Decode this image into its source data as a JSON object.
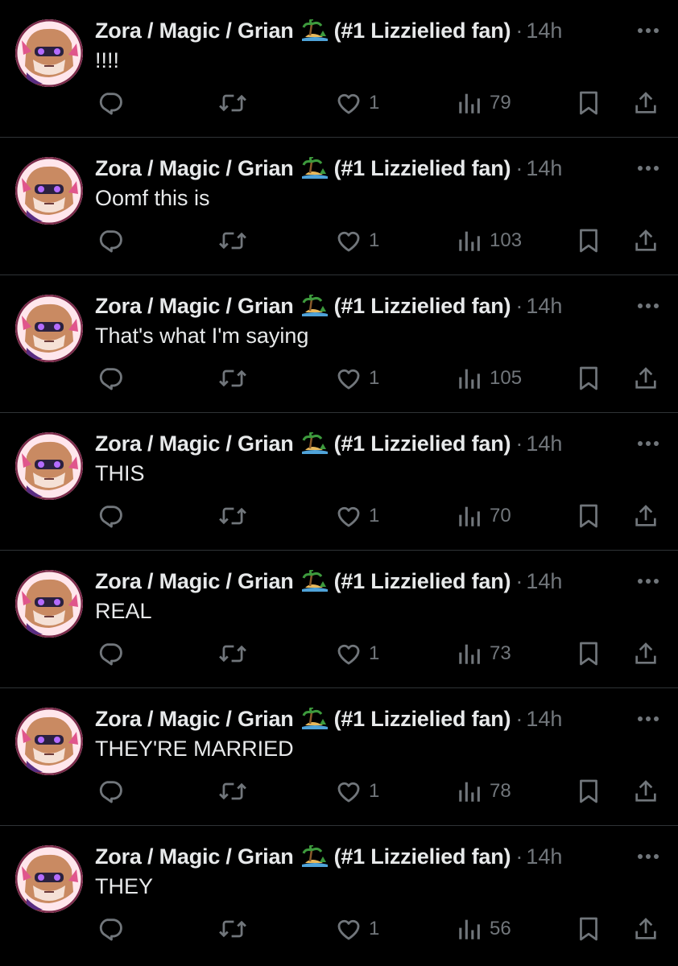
{
  "colors": {
    "background": "#000000",
    "text_primary": "#e7e9ea",
    "text_secondary": "#71767b",
    "divider": "#2f3336"
  },
  "icons": {
    "reply": "reply-icon",
    "retweet": "retweet-icon",
    "like": "heart-icon",
    "views": "views-icon",
    "bookmark": "bookmark-icon",
    "share": "share-icon",
    "more": "more-icon",
    "name_badge": "island-emoji"
  },
  "tweets": [
    {
      "name": "Zora / Magic / Grian",
      "name_suffix": "(#1 Lizzielied fan)",
      "separator": "·",
      "time": "14h",
      "text": "!!!!",
      "likes": "1",
      "views": "79"
    },
    {
      "name": "Zora / Magic / Grian",
      "name_suffix": "(#1 Lizzielied fan)",
      "separator": "·",
      "time": "14h",
      "text": "Oomf this is",
      "likes": "1",
      "views": "103"
    },
    {
      "name": "Zora / Magic / Grian",
      "name_suffix": "(#1 Lizzielied fan)",
      "separator": "·",
      "time": "14h",
      "text": "That's what I'm saying",
      "likes": "1",
      "views": "105"
    },
    {
      "name": "Zora / Magic / Grian",
      "name_suffix": "(#1 Lizzielied fan)",
      "separator": "·",
      "time": "14h",
      "text": "THIS",
      "likes": "1",
      "views": "70"
    },
    {
      "name": "Zora / Magic / Grian",
      "name_suffix": "(#1 Lizzielied fan)",
      "separator": "·",
      "time": "14h",
      "text": "REAL",
      "likes": "1",
      "views": "73"
    },
    {
      "name": "Zora / Magic / Grian",
      "name_suffix": "(#1 Lizzielied fan)",
      "separator": "·",
      "time": "14h",
      "text": "THEY'RE MARRIED",
      "likes": "1",
      "views": "78"
    },
    {
      "name": "Zora / Magic / Grian",
      "name_suffix": "(#1 Lizzielied fan)",
      "separator": "·",
      "time": "14h",
      "text": "THEY",
      "likes": "1",
      "views": "56"
    }
  ]
}
